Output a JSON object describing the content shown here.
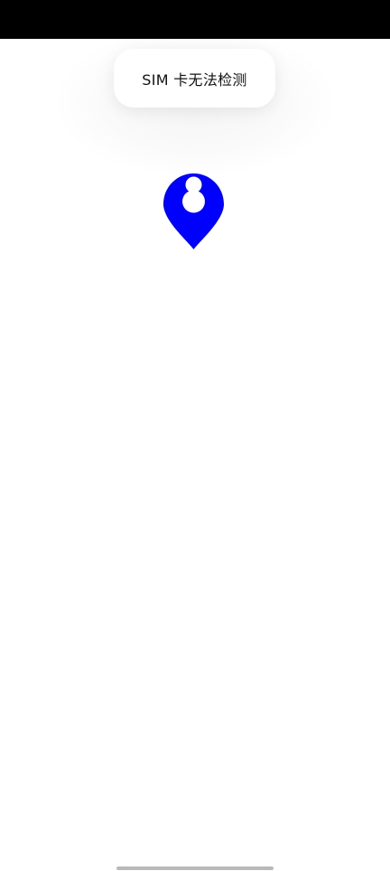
{
  "toast": {
    "message": "SIM 卡无法检测"
  },
  "map": {
    "marker_icon": "location-pin-icon",
    "marker_color": "#0000FF"
  },
  "colors": {
    "status_bar": "#000000",
    "background": "#FFFFFF",
    "home_indicator": "#B9B9B9"
  }
}
